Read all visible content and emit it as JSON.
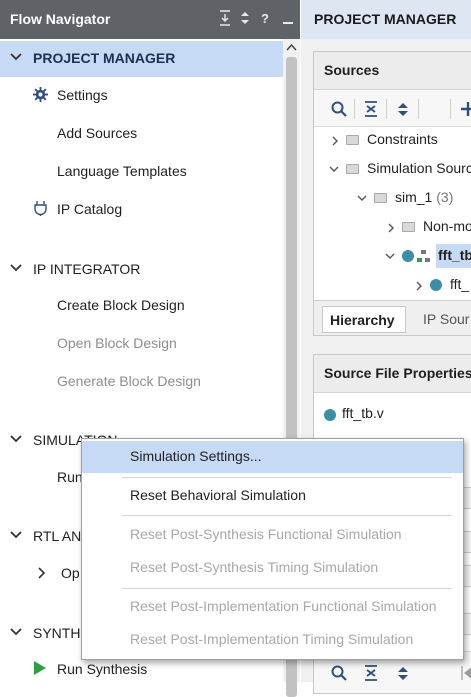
{
  "flow_navigator": {
    "title": "Flow Navigator",
    "header_controls": [
      "collapse-all-icon",
      "expand-sort-icon",
      "help-icon",
      "minimize-icon"
    ],
    "help_label": "?",
    "sections": [
      {
        "label": "PROJECT MANAGER",
        "expanded": true,
        "selected": true,
        "items": [
          {
            "label": "Settings",
            "icon": "gear-icon"
          },
          {
            "label": "Add Sources"
          },
          {
            "label": "Language Templates"
          },
          {
            "label": "IP Catalog",
            "icon": "plug-icon"
          }
        ]
      },
      {
        "label": "IP INTEGRATOR",
        "expanded": true,
        "items": [
          {
            "label": "Create Block Design",
            "enabled": true
          },
          {
            "label": "Open Block Design",
            "enabled": false
          },
          {
            "label": "Generate Block Design",
            "enabled": false
          }
        ]
      },
      {
        "label": "SIMULATION",
        "expanded": true,
        "items": [
          {
            "label": "Run"
          }
        ]
      },
      {
        "label": "RTL AN",
        "expanded": true,
        "items": [
          {
            "label": "Op"
          }
        ]
      },
      {
        "label": "SYNTH",
        "expanded": true,
        "items": [
          {
            "label": "Run Synthesis",
            "icon": "play-icon"
          }
        ]
      }
    ]
  },
  "project_manager": {
    "title": "PROJECT MANAGER",
    "sources": {
      "title": "Sources",
      "tree": [
        {
          "label": "Constraints"
        },
        {
          "label": "Simulation Source"
        },
        {
          "label": "sim_1",
          "count": "(3)"
        },
        {
          "label": "Non-mo"
        },
        {
          "label": "fft_tb"
        },
        {
          "label": "fft_"
        }
      ],
      "tabs": [
        "Hierarchy",
        "IP Sour"
      ]
    },
    "source_file_properties": {
      "title": "Source File Properties",
      "file": "fft_tb.v"
    },
    "colors": {
      "accent_selected": "#c7daf5",
      "header_dark": "#5f6368",
      "sim_dot": "#3a8ea5",
      "run_green": "#2ea043"
    }
  },
  "context_menu": {
    "items": [
      {
        "label": "Simulation Settings...",
        "enabled": true,
        "highlighted": true
      },
      {
        "label": "Reset Behavioral Simulation",
        "enabled": true
      },
      {
        "label": "Reset Post-Synthesis Functional Simulation",
        "enabled": false
      },
      {
        "label": "Reset Post-Synthesis Timing Simulation",
        "enabled": false
      },
      {
        "label": "Reset Post-Implementation Functional Simulation",
        "enabled": false
      },
      {
        "label": "Reset Post-Implementation Timing Simulation",
        "enabled": false
      }
    ]
  }
}
